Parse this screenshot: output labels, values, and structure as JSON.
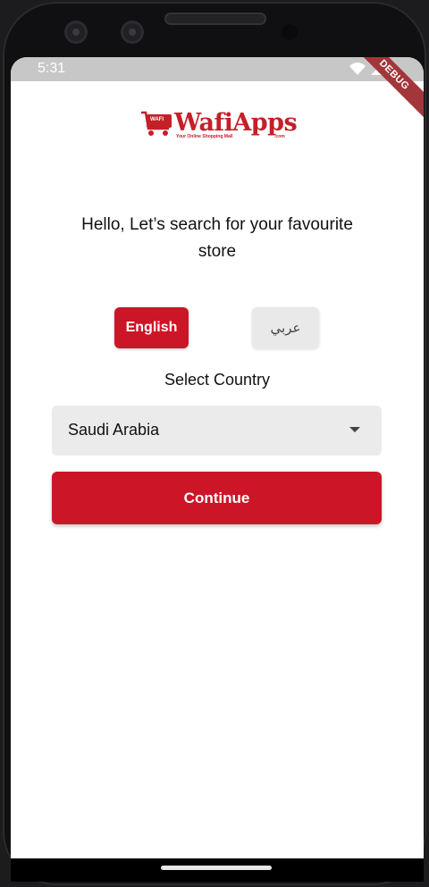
{
  "status_bar": {
    "time": "5:31",
    "debug_label": "DEBUG"
  },
  "logo": {
    "badge_text": "WAFI",
    "name": "WafiApps",
    "tagline": "Your Online Shopping Mall",
    "domain": ".com",
    "brand_color": "#c4202a"
  },
  "headline": "Hello, Let’s search for your favourite store",
  "language": {
    "english_label": "English",
    "arabic_label": "عربي",
    "selected": "English"
  },
  "country": {
    "label": "Select Country",
    "selected": "Saudi Arabia"
  },
  "continue_label": "Continue",
  "colors": {
    "accent": "#cd1528",
    "input_bg": "#ebebeb",
    "status_bar_bg": "#c7c7c7"
  }
}
